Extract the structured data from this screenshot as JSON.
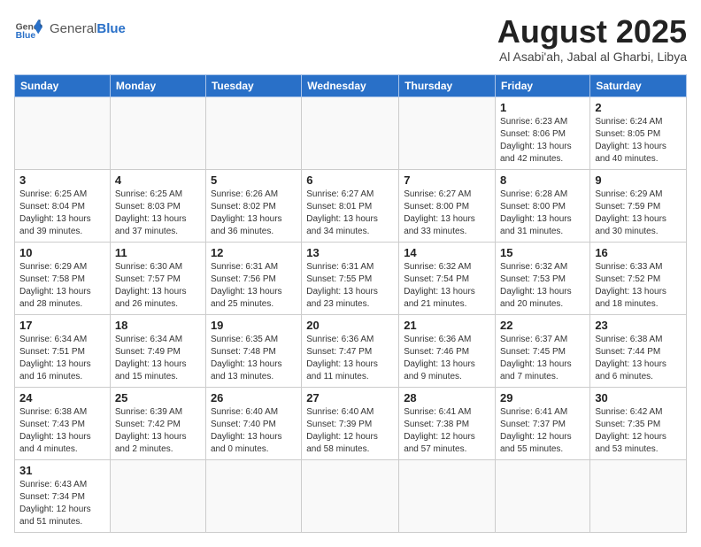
{
  "header": {
    "logo_general": "General",
    "logo_blue": "Blue",
    "title": "August 2025",
    "subtitle": "Al Asabi'ah, Jabal al Gharbi, Libya"
  },
  "weekdays": [
    "Sunday",
    "Monday",
    "Tuesday",
    "Wednesday",
    "Thursday",
    "Friday",
    "Saturday"
  ],
  "weeks": [
    [
      {
        "day": "",
        "info": ""
      },
      {
        "day": "",
        "info": ""
      },
      {
        "day": "",
        "info": ""
      },
      {
        "day": "",
        "info": ""
      },
      {
        "day": "",
        "info": ""
      },
      {
        "day": "1",
        "info": "Sunrise: 6:23 AM\nSunset: 8:06 PM\nDaylight: 13 hours and 42 minutes."
      },
      {
        "day": "2",
        "info": "Sunrise: 6:24 AM\nSunset: 8:05 PM\nDaylight: 13 hours and 40 minutes."
      }
    ],
    [
      {
        "day": "3",
        "info": "Sunrise: 6:25 AM\nSunset: 8:04 PM\nDaylight: 13 hours and 39 minutes."
      },
      {
        "day": "4",
        "info": "Sunrise: 6:25 AM\nSunset: 8:03 PM\nDaylight: 13 hours and 37 minutes."
      },
      {
        "day": "5",
        "info": "Sunrise: 6:26 AM\nSunset: 8:02 PM\nDaylight: 13 hours and 36 minutes."
      },
      {
        "day": "6",
        "info": "Sunrise: 6:27 AM\nSunset: 8:01 PM\nDaylight: 13 hours and 34 minutes."
      },
      {
        "day": "7",
        "info": "Sunrise: 6:27 AM\nSunset: 8:00 PM\nDaylight: 13 hours and 33 minutes."
      },
      {
        "day": "8",
        "info": "Sunrise: 6:28 AM\nSunset: 8:00 PM\nDaylight: 13 hours and 31 minutes."
      },
      {
        "day": "9",
        "info": "Sunrise: 6:29 AM\nSunset: 7:59 PM\nDaylight: 13 hours and 30 minutes."
      }
    ],
    [
      {
        "day": "10",
        "info": "Sunrise: 6:29 AM\nSunset: 7:58 PM\nDaylight: 13 hours and 28 minutes."
      },
      {
        "day": "11",
        "info": "Sunrise: 6:30 AM\nSunset: 7:57 PM\nDaylight: 13 hours and 26 minutes."
      },
      {
        "day": "12",
        "info": "Sunrise: 6:31 AM\nSunset: 7:56 PM\nDaylight: 13 hours and 25 minutes."
      },
      {
        "day": "13",
        "info": "Sunrise: 6:31 AM\nSunset: 7:55 PM\nDaylight: 13 hours and 23 minutes."
      },
      {
        "day": "14",
        "info": "Sunrise: 6:32 AM\nSunset: 7:54 PM\nDaylight: 13 hours and 21 minutes."
      },
      {
        "day": "15",
        "info": "Sunrise: 6:32 AM\nSunset: 7:53 PM\nDaylight: 13 hours and 20 minutes."
      },
      {
        "day": "16",
        "info": "Sunrise: 6:33 AM\nSunset: 7:52 PM\nDaylight: 13 hours and 18 minutes."
      }
    ],
    [
      {
        "day": "17",
        "info": "Sunrise: 6:34 AM\nSunset: 7:51 PM\nDaylight: 13 hours and 16 minutes."
      },
      {
        "day": "18",
        "info": "Sunrise: 6:34 AM\nSunset: 7:49 PM\nDaylight: 13 hours and 15 minutes."
      },
      {
        "day": "19",
        "info": "Sunrise: 6:35 AM\nSunset: 7:48 PM\nDaylight: 13 hours and 13 minutes."
      },
      {
        "day": "20",
        "info": "Sunrise: 6:36 AM\nSunset: 7:47 PM\nDaylight: 13 hours and 11 minutes."
      },
      {
        "day": "21",
        "info": "Sunrise: 6:36 AM\nSunset: 7:46 PM\nDaylight: 13 hours and 9 minutes."
      },
      {
        "day": "22",
        "info": "Sunrise: 6:37 AM\nSunset: 7:45 PM\nDaylight: 13 hours and 7 minutes."
      },
      {
        "day": "23",
        "info": "Sunrise: 6:38 AM\nSunset: 7:44 PM\nDaylight: 13 hours and 6 minutes."
      }
    ],
    [
      {
        "day": "24",
        "info": "Sunrise: 6:38 AM\nSunset: 7:43 PM\nDaylight: 13 hours and 4 minutes."
      },
      {
        "day": "25",
        "info": "Sunrise: 6:39 AM\nSunset: 7:42 PM\nDaylight: 13 hours and 2 minutes."
      },
      {
        "day": "26",
        "info": "Sunrise: 6:40 AM\nSunset: 7:40 PM\nDaylight: 13 hours and 0 minutes."
      },
      {
        "day": "27",
        "info": "Sunrise: 6:40 AM\nSunset: 7:39 PM\nDaylight: 12 hours and 58 minutes."
      },
      {
        "day": "28",
        "info": "Sunrise: 6:41 AM\nSunset: 7:38 PM\nDaylight: 12 hours and 57 minutes."
      },
      {
        "day": "29",
        "info": "Sunrise: 6:41 AM\nSunset: 7:37 PM\nDaylight: 12 hours and 55 minutes."
      },
      {
        "day": "30",
        "info": "Sunrise: 6:42 AM\nSunset: 7:35 PM\nDaylight: 12 hours and 53 minutes."
      }
    ],
    [
      {
        "day": "31",
        "info": "Sunrise: 6:43 AM\nSunset: 7:34 PM\nDaylight: 12 hours and 51 minutes."
      },
      {
        "day": "",
        "info": ""
      },
      {
        "day": "",
        "info": ""
      },
      {
        "day": "",
        "info": ""
      },
      {
        "day": "",
        "info": ""
      },
      {
        "day": "",
        "info": ""
      },
      {
        "day": "",
        "info": ""
      }
    ]
  ]
}
